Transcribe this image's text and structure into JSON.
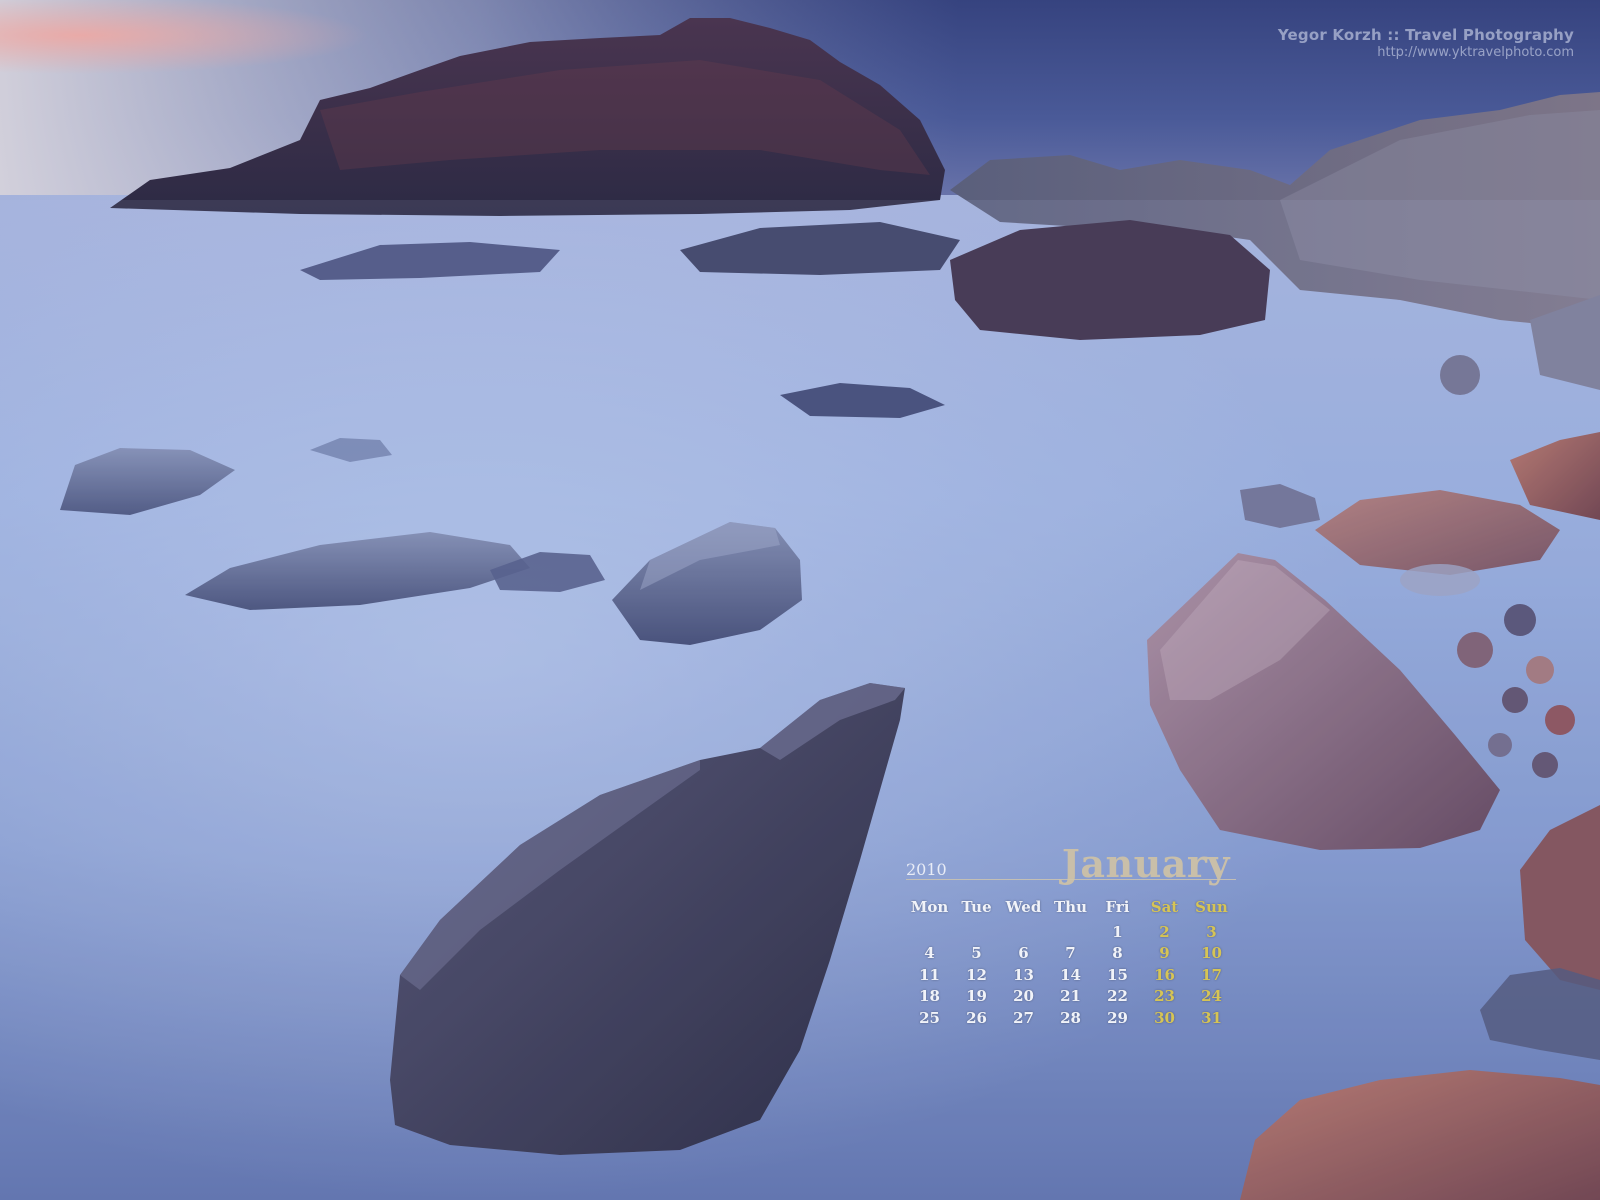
{
  "credit": {
    "photographer": "Yegor Korzh :: Travel Photography",
    "url": "http://www.yktravelphoto.com"
  },
  "calendar": {
    "year": "2010",
    "month": "January",
    "weekdays": [
      "Mon",
      "Tue",
      "Wed",
      "Thu",
      "Fri",
      "Sat",
      "Sun"
    ],
    "weeks": [
      [
        "",
        "",
        "",
        "",
        "1",
        "2",
        "3"
      ],
      [
        "4",
        "5",
        "6",
        "7",
        "8",
        "9",
        "10"
      ],
      [
        "11",
        "12",
        "13",
        "14",
        "15",
        "16",
        "17"
      ],
      [
        "18",
        "19",
        "20",
        "21",
        "22",
        "23",
        "24"
      ],
      [
        "25",
        "26",
        "27",
        "28",
        "29",
        "30",
        "31"
      ]
    ],
    "weekend_color": "#d6c455",
    "day_color": "#f1f3f9",
    "month_color": "#c9bfa9"
  },
  "scene": {
    "subject": "long-exposure rocky seashore at dusk",
    "palette": {
      "sky_top": "#3a4a86",
      "sky_horizon": "#cbbcc7",
      "sunset_glow": "#e7a6a3",
      "mist": "#8fa6d2",
      "rock_dark": "#2a2a42",
      "rock_warm": "#7e4c56"
    }
  }
}
